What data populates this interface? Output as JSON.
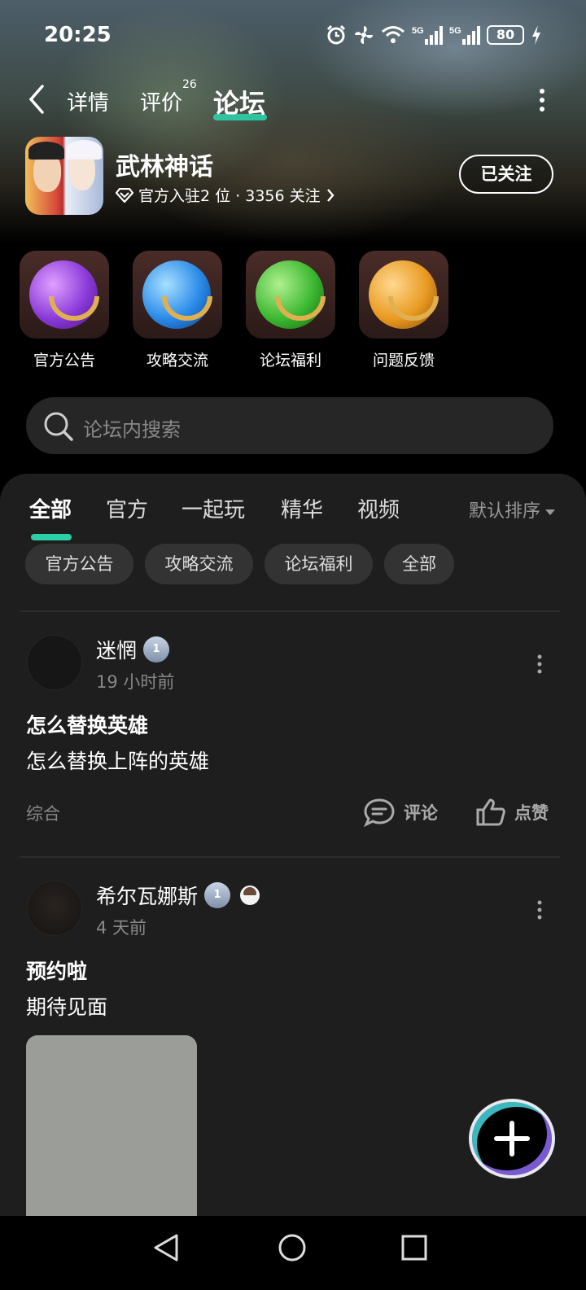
{
  "status_bar": {
    "time": "20:25",
    "battery": "80"
  },
  "header": {
    "tabs": [
      {
        "label": "详情"
      },
      {
        "label": "评价",
        "badge": "26"
      },
      {
        "label": "论坛"
      }
    ]
  },
  "game": {
    "name": "武林神话",
    "meta": "官方入驻2 位 · 3356 关注",
    "follow_label": "已关注"
  },
  "categories": [
    {
      "label": "官方公告",
      "color": "#8a3ad8"
    },
    {
      "label": "攻略交流",
      "color": "#2a8ae8"
    },
    {
      "label": "论坛福利",
      "color": "#3cb830"
    },
    {
      "label": "问题反馈",
      "color": "#e89a20"
    }
  ],
  "search": {
    "placeholder": "论坛内搜索"
  },
  "feed": {
    "tabs": [
      "全部",
      "官方",
      "一起玩",
      "精华",
      "视频"
    ],
    "sort_label": "默认排序",
    "chips": [
      "官方公告",
      "攻略交流",
      "论坛福利",
      "全部"
    ]
  },
  "posts": [
    {
      "author": "迷惘",
      "level": "1",
      "time": "19 小时前",
      "title": "怎么替换英雄",
      "body": "怎么替换上阵的英雄",
      "tag": "综合",
      "comment_label": "评论",
      "like_label": "点赞"
    },
    {
      "author": "希尔瓦娜斯",
      "level": "1",
      "time": "4 天前",
      "title": "预约啦",
      "body": "期待见面"
    }
  ],
  "accent_color": "#2bd0a8"
}
